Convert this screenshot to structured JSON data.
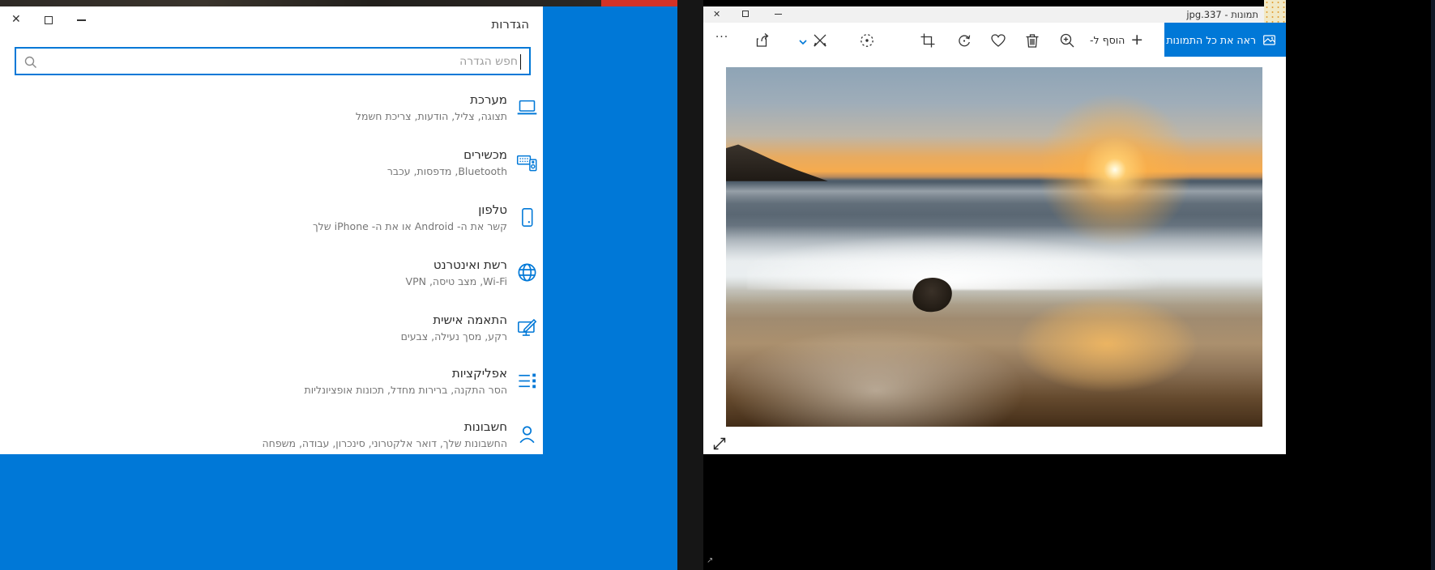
{
  "accent_color": "#0078d7",
  "settings_window": {
    "title": "הגדרות",
    "controls": {
      "close_glyph": "✕"
    },
    "search": {
      "placeholder": "חפש הגדרה",
      "value": ""
    },
    "items": [
      {
        "icon": "system-icon",
        "label": "מערכת",
        "desc": "תצוגה, צליל, הודעות, צריכת חשמל"
      },
      {
        "icon": "devices-icon",
        "label": "מכשירים",
        "desc": "Bluetooth, מדפסות, עכבר"
      },
      {
        "icon": "phone-icon",
        "label": "טלפון",
        "desc": "קשר את ה- Android או את ה- iPhone שלך"
      },
      {
        "icon": "network-icon",
        "label": "רשת ואינטרנט",
        "desc": "Wi-Fi, מצב טיסה, VPN"
      },
      {
        "icon": "personalization-icon",
        "label": "התאמה אישית",
        "desc": "רקע, מסך נעילה, צבעים"
      },
      {
        "icon": "apps-icon",
        "label": "אפליקציות",
        "desc": "הסר התקנה, ברירות מחדל, תכונות אופציונליות"
      },
      {
        "icon": "accounts-icon",
        "label": "חשבונות",
        "desc": "החשבונות שלך, דואר אלקטרוני, סינכרון, עבודה, משפחה"
      }
    ]
  },
  "photos_window": {
    "title": "תמונות - 337.jpg",
    "controls": {
      "close_glyph": "✕"
    },
    "toolbar": {
      "see_more_glyph": "···",
      "add_to_label": "הוסף ל-",
      "add_to_plus_glyph": "+",
      "see_all_photos_label": "ראה את כל התמונות",
      "icon_names": [
        "see-more",
        "share",
        "expand-chevron",
        "draw",
        "3d-effects",
        "crop",
        "rotate",
        "favorite",
        "delete",
        "zoom-in"
      ]
    }
  },
  "misc": {
    "corner_arrow_glyph": "↗"
  }
}
